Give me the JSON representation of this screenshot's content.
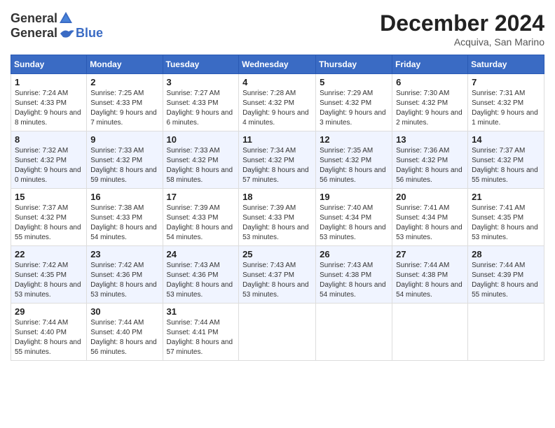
{
  "header": {
    "logo_general": "General",
    "logo_blue": "Blue",
    "month_title": "December 2024",
    "location": "Acquiva, San Marino"
  },
  "days_of_week": [
    "Sunday",
    "Monday",
    "Tuesday",
    "Wednesday",
    "Thursday",
    "Friday",
    "Saturday"
  ],
  "weeks": [
    [
      {
        "day": 1,
        "sunrise": "7:24 AM",
        "sunset": "4:33 PM",
        "daylight": "9 hours and 8 minutes."
      },
      {
        "day": 2,
        "sunrise": "7:25 AM",
        "sunset": "4:33 PM",
        "daylight": "9 hours and 7 minutes."
      },
      {
        "day": 3,
        "sunrise": "7:27 AM",
        "sunset": "4:33 PM",
        "daylight": "9 hours and 6 minutes."
      },
      {
        "day": 4,
        "sunrise": "7:28 AM",
        "sunset": "4:32 PM",
        "daylight": "9 hours and 4 minutes."
      },
      {
        "day": 5,
        "sunrise": "7:29 AM",
        "sunset": "4:32 PM",
        "daylight": "9 hours and 3 minutes."
      },
      {
        "day": 6,
        "sunrise": "7:30 AM",
        "sunset": "4:32 PM",
        "daylight": "9 hours and 2 minutes."
      },
      {
        "day": 7,
        "sunrise": "7:31 AM",
        "sunset": "4:32 PM",
        "daylight": "9 hours and 1 minute."
      }
    ],
    [
      {
        "day": 8,
        "sunrise": "7:32 AM",
        "sunset": "4:32 PM",
        "daylight": "9 hours and 0 minutes."
      },
      {
        "day": 9,
        "sunrise": "7:33 AM",
        "sunset": "4:32 PM",
        "daylight": "8 hours and 59 minutes."
      },
      {
        "day": 10,
        "sunrise": "7:33 AM",
        "sunset": "4:32 PM",
        "daylight": "8 hours and 58 minutes."
      },
      {
        "day": 11,
        "sunrise": "7:34 AM",
        "sunset": "4:32 PM",
        "daylight": "8 hours and 57 minutes."
      },
      {
        "day": 12,
        "sunrise": "7:35 AM",
        "sunset": "4:32 PM",
        "daylight": "8 hours and 56 minutes."
      },
      {
        "day": 13,
        "sunrise": "7:36 AM",
        "sunset": "4:32 PM",
        "daylight": "8 hours and 56 minutes."
      },
      {
        "day": 14,
        "sunrise": "7:37 AM",
        "sunset": "4:32 PM",
        "daylight": "8 hours and 55 minutes."
      }
    ],
    [
      {
        "day": 15,
        "sunrise": "7:37 AM",
        "sunset": "4:32 PM",
        "daylight": "8 hours and 55 minutes."
      },
      {
        "day": 16,
        "sunrise": "7:38 AM",
        "sunset": "4:33 PM",
        "daylight": "8 hours and 54 minutes."
      },
      {
        "day": 17,
        "sunrise": "7:39 AM",
        "sunset": "4:33 PM",
        "daylight": "8 hours and 54 minutes."
      },
      {
        "day": 18,
        "sunrise": "7:39 AM",
        "sunset": "4:33 PM",
        "daylight": "8 hours and 53 minutes."
      },
      {
        "day": 19,
        "sunrise": "7:40 AM",
        "sunset": "4:34 PM",
        "daylight": "8 hours and 53 minutes."
      },
      {
        "day": 20,
        "sunrise": "7:41 AM",
        "sunset": "4:34 PM",
        "daylight": "8 hours and 53 minutes."
      },
      {
        "day": 21,
        "sunrise": "7:41 AM",
        "sunset": "4:35 PM",
        "daylight": "8 hours and 53 minutes."
      }
    ],
    [
      {
        "day": 22,
        "sunrise": "7:42 AM",
        "sunset": "4:35 PM",
        "daylight": "8 hours and 53 minutes."
      },
      {
        "day": 23,
        "sunrise": "7:42 AM",
        "sunset": "4:36 PM",
        "daylight": "8 hours and 53 minutes."
      },
      {
        "day": 24,
        "sunrise": "7:43 AM",
        "sunset": "4:36 PM",
        "daylight": "8 hours and 53 minutes."
      },
      {
        "day": 25,
        "sunrise": "7:43 AM",
        "sunset": "4:37 PM",
        "daylight": "8 hours and 53 minutes."
      },
      {
        "day": 26,
        "sunrise": "7:43 AM",
        "sunset": "4:38 PM",
        "daylight": "8 hours and 54 minutes."
      },
      {
        "day": 27,
        "sunrise": "7:44 AM",
        "sunset": "4:38 PM",
        "daylight": "8 hours and 54 minutes."
      },
      {
        "day": 28,
        "sunrise": "7:44 AM",
        "sunset": "4:39 PM",
        "daylight": "8 hours and 55 minutes."
      }
    ],
    [
      {
        "day": 29,
        "sunrise": "7:44 AM",
        "sunset": "4:40 PM",
        "daylight": "8 hours and 55 minutes."
      },
      {
        "day": 30,
        "sunrise": "7:44 AM",
        "sunset": "4:40 PM",
        "daylight": "8 hours and 56 minutes."
      },
      {
        "day": 31,
        "sunrise": "7:44 AM",
        "sunset": "4:41 PM",
        "daylight": "8 hours and 57 minutes."
      },
      null,
      null,
      null,
      null
    ]
  ]
}
